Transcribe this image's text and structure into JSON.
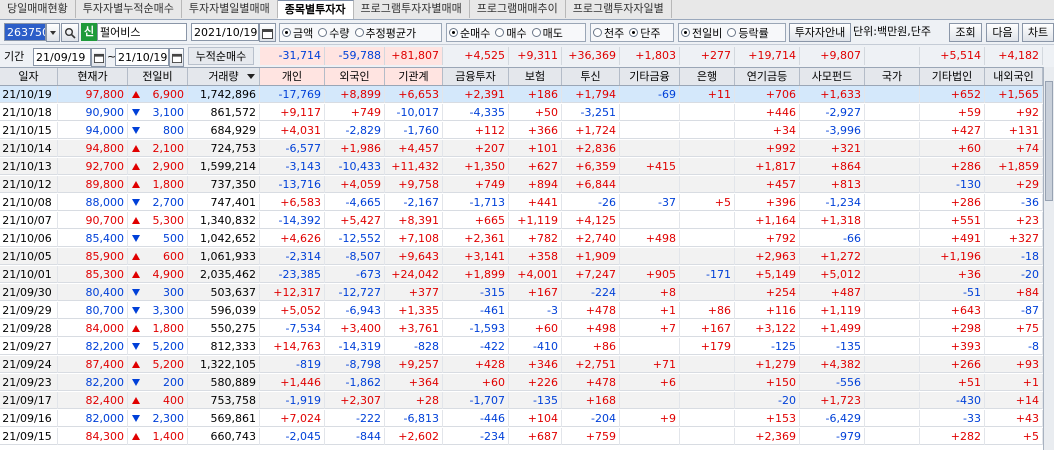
{
  "tabs": [
    "당일매매현황",
    "투자자별누적순매수",
    "투자자별일별매매",
    "종목별투자자",
    "프로그램투자자별매매",
    "프로그램매매추이",
    "프로그램투자자일별"
  ],
  "active_tab": 3,
  "toolbar": {
    "code": "263750",
    "badge": "신",
    "name": "펄어비스",
    "date": "2021/10/19",
    "radio_group1": [
      {
        "label": "금액",
        "on": true
      },
      {
        "label": "수량",
        "on": false
      },
      {
        "label": "추정평균가",
        "on": false
      }
    ],
    "radio_group2": [
      {
        "label": "순매수",
        "on": true
      },
      {
        "label": "매수",
        "on": false
      },
      {
        "label": "매도",
        "on": false
      }
    ],
    "radio_group3": [
      {
        "label": "천주",
        "on": false
      },
      {
        "label": "단주",
        "on": true
      }
    ],
    "radio_group4": [
      {
        "label": "전일비",
        "on": true
      },
      {
        "label": "등락률",
        "on": false
      }
    ],
    "info_button": "투자자안내",
    "unit_label": "단위:백만원,단주",
    "query_button": "조회",
    "next_button": "다음",
    "chart_button": "차트"
  },
  "period": {
    "label": "기간",
    "from": "21/09/19",
    "tilde": "~",
    "to": "21/10/19",
    "cumulative_label": "누적순매수"
  },
  "sums": [
    "-31,714",
    "-59,788",
    "+81,807",
    "+4,525",
    "+9,311",
    "+36,369",
    "+1,803",
    "+277",
    "+19,714",
    "+9,807",
    "",
    "+5,514",
    "+4,182"
  ],
  "headers": [
    "일자",
    "현재가",
    "전일비",
    "거래량",
    "개인",
    "외국인",
    "기관계",
    "금융투자",
    "보험",
    "투신",
    "기타금융",
    "은행",
    "연기금등",
    "사모펀드",
    "국가",
    "기타법인",
    "내외국인"
  ],
  "rows": [
    {
      "d": "21/10/19",
      "p": "97,800",
      "dir": "up",
      "ch": "6,900",
      "v": "1,742,896",
      "vals": [
        "-17,769",
        "+8,899",
        "+6,653",
        "+2,391",
        "+186",
        "+1,794",
        "-69",
        "+11",
        "+706",
        "+1,633",
        "",
        "+652",
        "+1,565"
      ]
    },
    {
      "d": "21/10/18",
      "p": "90,900",
      "dir": "dn",
      "ch": "3,100",
      "v": "861,572",
      "vals": [
        "+9,117",
        "+749",
        "-10,017",
        "-4,335",
        "+50",
        "-3,251",
        "",
        "",
        "+446",
        "-2,927",
        "",
        "+59",
        "+92"
      ]
    },
    {
      "d": "21/10/15",
      "p": "94,000",
      "dir": "dn",
      "ch": "800",
      "v": "684,929",
      "vals": [
        "+4,031",
        "-2,829",
        "-1,760",
        "+112",
        "+366",
        "+1,724",
        "",
        "",
        "+34",
        "-3,996",
        "",
        "+427",
        "+131"
      ]
    },
    {
      "d": "21/10/14",
      "p": "94,800",
      "dir": "up",
      "ch": "2,100",
      "v": "724,753",
      "vals": [
        "-6,577",
        "+1,986",
        "+4,457",
        "+207",
        "+101",
        "+2,836",
        "",
        "",
        "+992",
        "+321",
        "",
        "+60",
        "+74"
      ]
    },
    {
      "d": "21/10/13",
      "p": "92,700",
      "dir": "up",
      "ch": "2,900",
      "v": "1,599,214",
      "vals": [
        "-3,143",
        "-10,433",
        "+11,432",
        "+1,350",
        "+627",
        "+6,359",
        "+415",
        "",
        "+1,817",
        "+864",
        "",
        "+286",
        "+1,859"
      ]
    },
    {
      "d": "21/10/12",
      "p": "89,800",
      "dir": "up",
      "ch": "1,800",
      "v": "737,350",
      "vals": [
        "-13,716",
        "+4,059",
        "+9,758",
        "+749",
        "+894",
        "+6,844",
        "",
        "",
        "+457",
        "+813",
        "",
        "-130",
        "+29"
      ]
    },
    {
      "d": "21/10/08",
      "p": "88,000",
      "dir": "dn",
      "ch": "2,700",
      "v": "747,401",
      "vals": [
        "+6,583",
        "-4,665",
        "-2,167",
        "-1,713",
        "+441",
        "-26",
        "-37",
        "+5",
        "+396",
        "-1,234",
        "",
        "+286",
        "-36"
      ]
    },
    {
      "d": "21/10/07",
      "p": "90,700",
      "dir": "up",
      "ch": "5,300",
      "v": "1,340,832",
      "vals": [
        "-14,392",
        "+5,427",
        "+8,391",
        "+665",
        "+1,119",
        "+4,125",
        "",
        "",
        "+1,164",
        "+1,318",
        "",
        "+551",
        "+23"
      ]
    },
    {
      "d": "21/10/06",
      "p": "85,400",
      "dir": "dn",
      "ch": "500",
      "v": "1,042,652",
      "vals": [
        "+4,626",
        "-12,552",
        "+7,108",
        "+2,361",
        "+782",
        "+2,740",
        "+498",
        "",
        "+792",
        "-66",
        "",
        "+491",
        "+327"
      ]
    },
    {
      "d": "21/10/05",
      "p": "85,900",
      "dir": "up",
      "ch": "600",
      "v": "1,061,933",
      "vals": [
        "-2,314",
        "-8,507",
        "+9,643",
        "+3,141",
        "+358",
        "+1,909",
        "",
        "",
        "+2,963",
        "+1,272",
        "",
        "+1,196",
        "-18"
      ]
    },
    {
      "d": "21/10/01",
      "p": "85,300",
      "dir": "up",
      "ch": "4,900",
      "v": "2,035,462",
      "vals": [
        "-23,385",
        "-673",
        "+24,042",
        "+1,899",
        "+4,001",
        "+7,247",
        "+905",
        "-171",
        "+5,149",
        "+5,012",
        "",
        "+36",
        "-20"
      ]
    },
    {
      "d": "21/09/30",
      "p": "80,400",
      "dir": "dn",
      "ch": "300",
      "v": "503,637",
      "vals": [
        "+12,317",
        "-12,727",
        "+377",
        "-315",
        "+167",
        "-224",
        "+8",
        "",
        "+254",
        "+487",
        "",
        "-51",
        "+84"
      ]
    },
    {
      "d": "21/09/29",
      "p": "80,700",
      "dir": "dn",
      "ch": "3,300",
      "v": "596,039",
      "vals": [
        "+5,052",
        "-6,943",
        "+1,335",
        "-461",
        "-3",
        "+478",
        "+1",
        "+86",
        "+116",
        "+1,119",
        "",
        "+643",
        "-87"
      ]
    },
    {
      "d": "21/09/28",
      "p": "84,000",
      "dir": "up",
      "ch": "1,800",
      "v": "550,275",
      "vals": [
        "-7,534",
        "+3,400",
        "+3,761",
        "-1,593",
        "+60",
        "+498",
        "+7",
        "+167",
        "+3,122",
        "+1,499",
        "",
        "+298",
        "+75"
      ]
    },
    {
      "d": "21/09/27",
      "p": "82,200",
      "dir": "dn",
      "ch": "5,200",
      "v": "812,333",
      "vals": [
        "+14,763",
        "-14,319",
        "-828",
        "-422",
        "-410",
        "+86",
        "",
        "+179",
        "-125",
        "-135",
        "",
        "+393",
        "-8"
      ]
    },
    {
      "d": "21/09/24",
      "p": "87,400",
      "dir": "up",
      "ch": "5,200",
      "v": "1,322,105",
      "vals": [
        "-819",
        "-8,798",
        "+9,257",
        "+428",
        "+346",
        "+2,751",
        "+71",
        "",
        "+1,279",
        "+4,382",
        "",
        "+266",
        "+93"
      ]
    },
    {
      "d": "21/09/23",
      "p": "82,200",
      "dir": "dn",
      "ch": "200",
      "v": "580,889",
      "vals": [
        "+1,446",
        "-1,862",
        "+364",
        "+60",
        "+226",
        "+478",
        "+6",
        "",
        "+150",
        "-556",
        "",
        "+51",
        "+1"
      ]
    },
    {
      "d": "21/09/17",
      "p": "82,400",
      "dir": "up",
      "ch": "400",
      "v": "753,758",
      "vals": [
        "-1,919",
        "+2,307",
        "+28",
        "-1,707",
        "-135",
        "+168",
        "",
        "",
        "-20",
        "+1,723",
        "",
        "-430",
        "+14"
      ]
    },
    {
      "d": "21/09/16",
      "p": "82,000",
      "dir": "dn",
      "ch": "2,300",
      "v": "569,861",
      "vals": [
        "+7,024",
        "-222",
        "-6,813",
        "-446",
        "+104",
        "-204",
        "+9",
        "",
        "+153",
        "-6,429",
        "",
        "-33",
        "+43"
      ]
    },
    {
      "d": "21/09/15",
      "p": "84,300",
      "dir": "up",
      "ch": "1,400",
      "v": "660,743",
      "vals": [
        "-2,045",
        "-844",
        "+2,602",
        "-234",
        "+687",
        "+759",
        "",
        "",
        "+2,369",
        "-979",
        "",
        "+282",
        "+5"
      ]
    }
  ],
  "colors": {
    "up": "#e00000",
    "down": "#0040d8",
    "highlight": "#d4e8fb",
    "alt": "#f2f2f2",
    "sort": "#ffe4e1"
  }
}
